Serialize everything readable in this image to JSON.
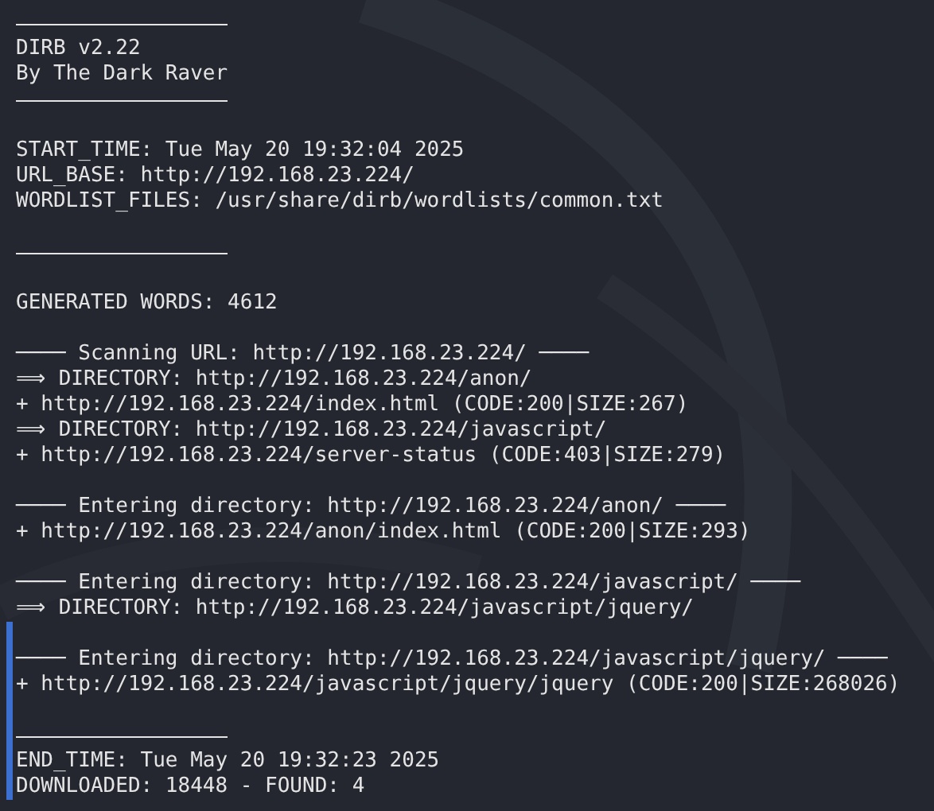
{
  "terminal": {
    "lines": [
      {
        "kind": "rule",
        "marked": false
      },
      {
        "kind": "text",
        "text": "DIRB v2.22",
        "marked": false
      },
      {
        "kind": "text",
        "text": "By The Dark Raver",
        "marked": false
      },
      {
        "kind": "rule",
        "marked": false
      },
      {
        "kind": "blank",
        "marked": false
      },
      {
        "kind": "text",
        "text": "START_TIME: Tue May 20 19:32:04 2025",
        "marked": false
      },
      {
        "kind": "text",
        "text": "URL_BASE: http://192.168.23.224/",
        "marked": false
      },
      {
        "kind": "text",
        "text": "WORDLIST_FILES: /usr/share/dirb/wordlists/common.txt",
        "marked": false
      },
      {
        "kind": "blank",
        "marked": false
      },
      {
        "kind": "rule",
        "marked": false
      },
      {
        "kind": "blank",
        "marked": false
      },
      {
        "kind": "text",
        "text": "GENERATED WORDS: 4612",
        "marked": false
      },
      {
        "kind": "blank",
        "marked": false
      },
      {
        "kind": "text",
        "text": "──── Scanning URL: http://192.168.23.224/ ────",
        "marked": false
      },
      {
        "kind": "text",
        "text": "⟹ DIRECTORY: http://192.168.23.224/anon/",
        "marked": false
      },
      {
        "kind": "text",
        "text": "+ http://192.168.23.224/index.html (CODE:200|SIZE:267)",
        "marked": false
      },
      {
        "kind": "text",
        "text": "⟹ DIRECTORY: http://192.168.23.224/javascript/",
        "marked": false
      },
      {
        "kind": "text",
        "text": "+ http://192.168.23.224/server-status (CODE:403|SIZE:279)",
        "marked": false
      },
      {
        "kind": "blank",
        "marked": false
      },
      {
        "kind": "text",
        "text": "──── Entering directory: http://192.168.23.224/anon/ ────",
        "marked": false
      },
      {
        "kind": "text",
        "text": "+ http://192.168.23.224/anon/index.html (CODE:200|SIZE:293)",
        "marked": false
      },
      {
        "kind": "blank",
        "marked": false
      },
      {
        "kind": "text",
        "text": "──── Entering directory: http://192.168.23.224/javascript/ ────",
        "marked": false
      },
      {
        "kind": "text",
        "text": "⟹ DIRECTORY: http://192.168.23.224/javascript/jquery/",
        "marked": false
      },
      {
        "kind": "blank",
        "marked": true
      },
      {
        "kind": "text",
        "text": "──── Entering directory: http://192.168.23.224/javascript/jquery/ ────",
        "marked": true
      },
      {
        "kind": "text",
        "text": "+ http://192.168.23.224/javascript/jquery/jquery (CODE:200|SIZE:268026)",
        "marked": true
      },
      {
        "kind": "blank",
        "marked": true
      },
      {
        "kind": "rule",
        "marked": true
      },
      {
        "kind": "text",
        "text": "END_TIME: Tue May 20 19:32:23 2025",
        "marked": true
      },
      {
        "kind": "text",
        "text": "DOWNLOADED: 18448 - FOUND: 4",
        "marked": true
      }
    ]
  }
}
